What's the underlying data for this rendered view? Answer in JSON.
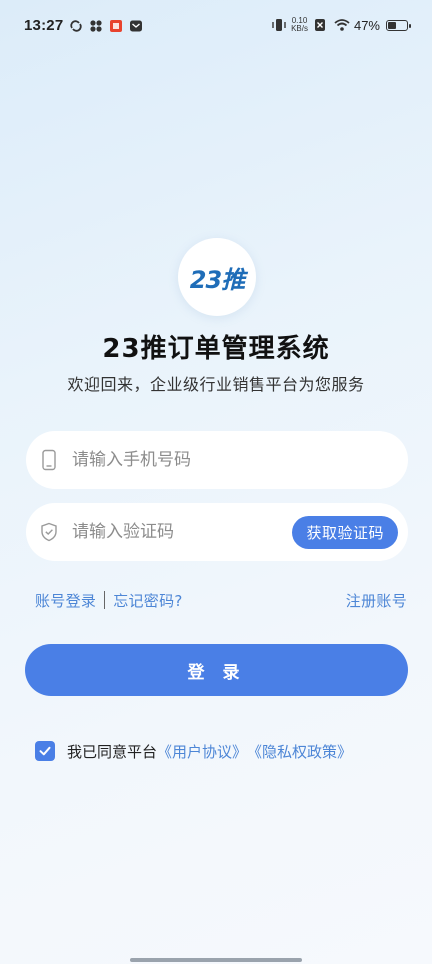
{
  "status_bar": {
    "time": "13:27",
    "net_speed_value": "0.10",
    "net_speed_unit": "KB/s",
    "battery_percent": "47%",
    "battery_level": 0.47,
    "icons": [
      "sync-icon",
      "grid-app-icon",
      "red-app-icon",
      "mail-icon",
      "vibrate-icon",
      "sim-icon",
      "wifi-icon",
      "battery-icon"
    ]
  },
  "app": {
    "logo_text": "23推",
    "title": "23推订单管理系统",
    "subtitle": "欢迎回来，企业级行业销售平台为您服务"
  },
  "form": {
    "phone_placeholder": "请输入手机号码",
    "phone_value": "",
    "code_placeholder": "请输入验证码",
    "code_value": "",
    "get_code_label": "获取验证码"
  },
  "links": {
    "account_login": "账号登录",
    "forgot_password": "忘记密码?",
    "register": "注册账号"
  },
  "login_label": "登 录",
  "agreement": {
    "checked": true,
    "prefix": "我已同意平台",
    "user_agreement": "《用户协议》",
    "privacy_policy": "《隐私权政策》"
  },
  "colors": {
    "accent": "#4a7fe6",
    "link": "#4d86d6",
    "logo_blue": "#1f6db8"
  }
}
